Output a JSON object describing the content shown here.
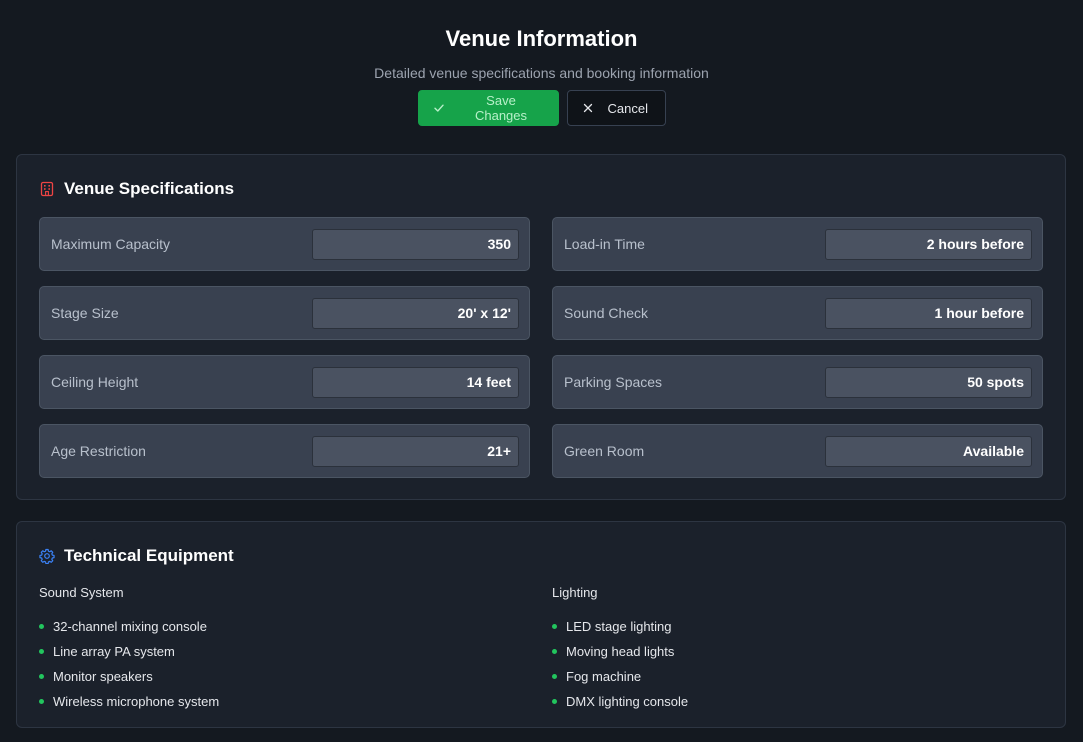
{
  "header": {
    "title": "Venue Information",
    "subtitle": "Detailed venue specifications and booking information"
  },
  "actions": {
    "save_label": "Save Changes",
    "cancel_label": "Cancel"
  },
  "specs": {
    "title": "Venue Specifications",
    "items": [
      {
        "label": "Maximum Capacity",
        "value": "350"
      },
      {
        "label": "Load-in Time",
        "value": "2 hours before"
      },
      {
        "label": "Stage Size",
        "value": "20' x 12'"
      },
      {
        "label": "Sound Check",
        "value": "1 hour before"
      },
      {
        "label": "Ceiling Height",
        "value": "14 feet"
      },
      {
        "label": "Parking Spaces",
        "value": "50 spots"
      },
      {
        "label": "Age Restriction",
        "value": "21+"
      },
      {
        "label": "Green Room",
        "value": "Available"
      }
    ]
  },
  "equipment": {
    "title": "Technical Equipment",
    "sound": {
      "heading": "Sound System",
      "items": [
        "32-channel mixing console",
        "Line array PA system",
        "Monitor speakers",
        "Wireless microphone system"
      ]
    },
    "lighting": {
      "heading": "Lighting",
      "items": [
        "LED stage lighting",
        "Moving head lights",
        "Fog machine",
        "DMX lighting console"
      ]
    }
  },
  "icons": {
    "specs_icon": "building-icon",
    "equipment_icon": "gear-icon",
    "save_icon": "check-icon",
    "cancel_icon": "close-icon"
  },
  "colors": {
    "accent_green": "#16a34a",
    "bullet_green": "#22c55e",
    "building_icon": "#ef4444",
    "gear_icon": "#3b82f6"
  }
}
